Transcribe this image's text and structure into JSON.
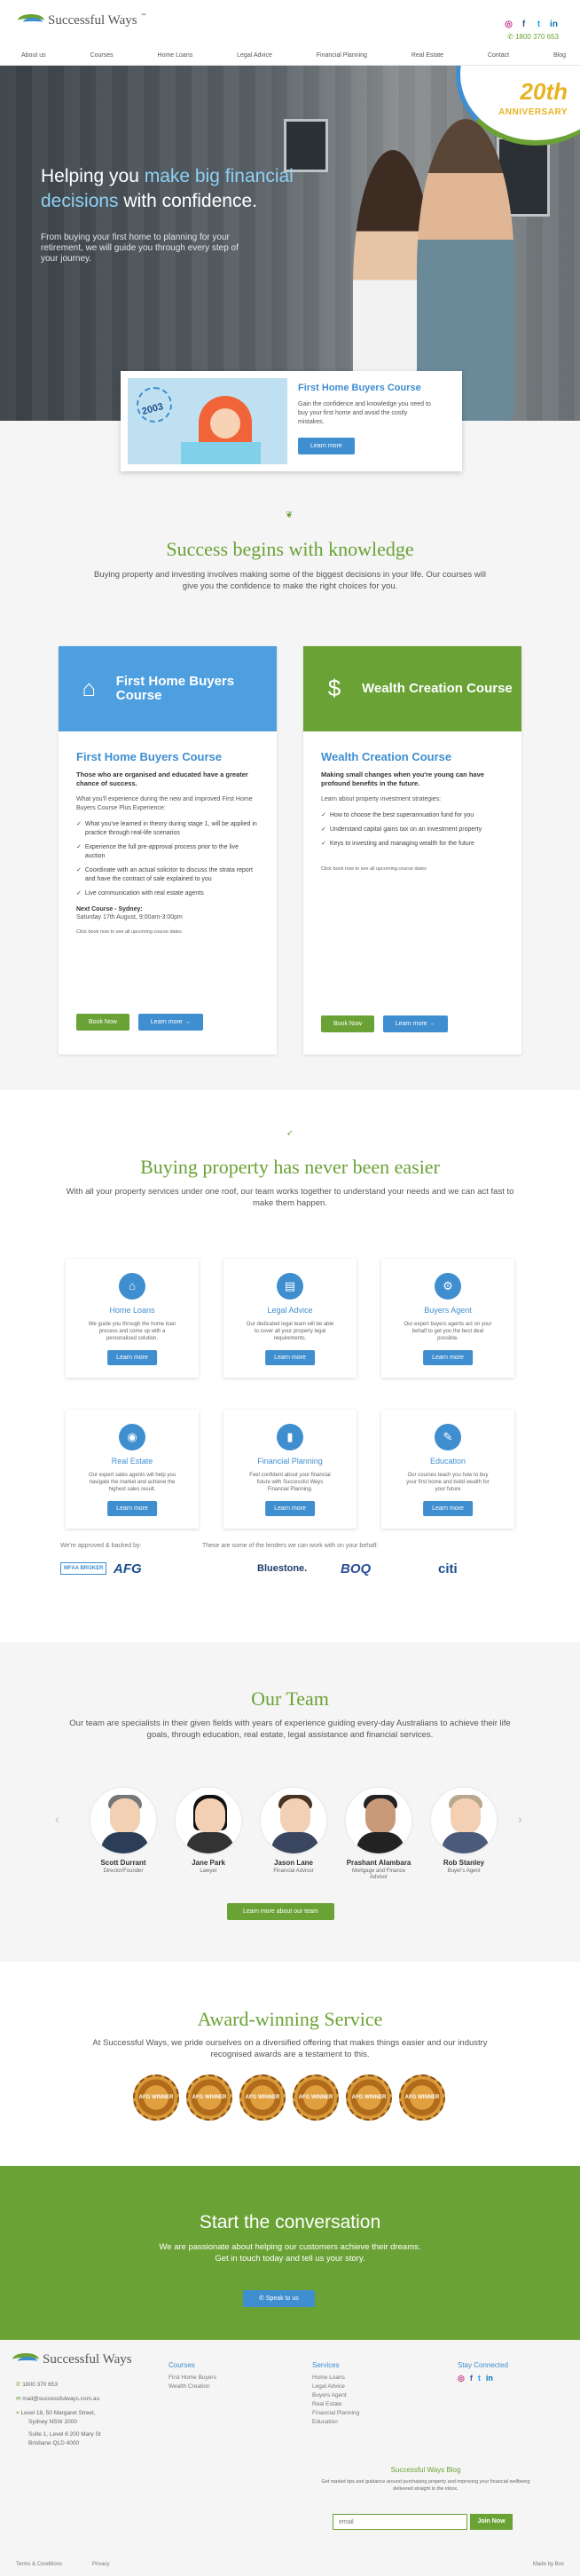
{
  "brand": {
    "name": "Successful Ways",
    "tm": "™",
    "phone": "1800 370 653"
  },
  "social": [
    "instagram-icon",
    "facebook-icon",
    "twitter-icon",
    "linkedin-icon"
  ],
  "social_glyphs": {
    "instagram": "◎",
    "facebook": "f",
    "twitter": "t",
    "linkedin": "in"
  },
  "nav": [
    "About us",
    "Courses",
    "Home Loans",
    "Legal Advice",
    "Financial Planning",
    "Real Estate",
    "Contact",
    "Blog"
  ],
  "anniversary": {
    "number": "20th",
    "label": "ANNIVERSARY"
  },
  "hero": {
    "title_a": "Helping you ",
    "title_hl": "make big financial decisions",
    "title_b": " with confidence.",
    "subtitle": "From buying your first home to planning for your retirement, we will guide you through every step of your journey."
  },
  "promo": {
    "badge": "2003",
    "title": "First Home Buyers Course",
    "desc": "Gain the confidence and knowledge you need to buy your first home and avoid the costly mistakes.",
    "button": "Learn more"
  },
  "knowledge": {
    "title": "Success begins with knowledge",
    "lead": "Buying property and investing involves making some of the biggest decisions in your life. Our courses will give you the confidence to make the right choices for you."
  },
  "course1": {
    "header": "First Home Buyers Course",
    "title": "First Home Buyers Course",
    "bold": "Those who are organised and educated have a greater chance of success.",
    "intro": "What you'll experience during the new and improved First Home Buyers Course Plus Experience:",
    "points": [
      "What you've learned in theory during stage 1, will be applied in practice through real-life scenarios",
      "Experience the full pre-approval process prior to the live auction",
      "Coordinate with an actual solicitor to discuss the strata report and have the contract of sale explained to you",
      "Live communication with real estate agents"
    ],
    "next_label": "Next Course - Sydney:",
    "next_date": "Saturday 17th August, 9:00am-3:00pm",
    "note": "Click book now to see all upcoming course dates",
    "book": "Book Now",
    "learn": "Learn more →"
  },
  "course2": {
    "header": "Wealth Creation Course",
    "title": "Wealth Creation Course",
    "bold": "Making small changes when you're young can have profound benefits in the future.",
    "intro": "Learn about property investment strategies:",
    "points": [
      "How to choose the best superannuation fund for you",
      "Understand capital gains tax on an investment property",
      "Keys to investing and managing wealth for the future"
    ],
    "note": "Click book now to see all upcoming course dates",
    "book": "Book Now",
    "learn": "Learn more →"
  },
  "services": {
    "title": "Buying property has never been easier",
    "lead": "With all your property services under one roof, our team works together to understand your needs and we can act fast to make them happen.",
    "items": [
      {
        "name": "Home Loans",
        "desc": "We guide you through the home loan process and come up with a personalised solution.",
        "button": "Learn more"
      },
      {
        "name": "Legal Advice",
        "desc": "Our dedicated legal team will be able to cover all your property legal requirements.",
        "button": "Learn more"
      },
      {
        "name": "Buyers Agent",
        "desc": "Our expert buyers agents act on your behalf to get you the best deal possible.",
        "button": "Learn more"
      },
      {
        "name": "Real Estate",
        "desc": "Our expert sales agents will help you navigate the market and achieve the highest sales result.",
        "button": "Learn more"
      },
      {
        "name": "Financial Planning",
        "desc": "Feel confident about your financial future with Successful Ways Financial Planning.",
        "button": "Learn more"
      },
      {
        "name": "Education",
        "desc": "Our courses teach you how to buy your first home and build wealth for your future",
        "button": "Learn more"
      }
    ],
    "icon_glyphs": [
      "⌂",
      "▤",
      "⚙",
      "◉",
      "▮",
      "✎"
    ],
    "approved_label": "We're approved & backed by:",
    "lenders_label": "These are some of the lenders we can work with on your behalf:",
    "logos": [
      "MFAA BROKER",
      "AFG",
      "Bluestone.",
      "BOQ",
      "citi"
    ]
  },
  "team": {
    "title": "Our Team",
    "lead": "Our team are specialists in their given fields with years of experience guiding every-day Australians to achieve their life goals, through education, real estate, legal assistance and financial services.",
    "members": [
      {
        "name": "Scott Durrant",
        "role": "Director/Founder"
      },
      {
        "name": "Jane Park",
        "role": "Lawyer"
      },
      {
        "name": "Jason Lane",
        "role": "Financial Advisor"
      },
      {
        "name": "Prashant Alambara",
        "role": "Mortgage and Finance Advisor"
      },
      {
        "name": "Rob Stanley",
        "role": "Buyer's Agent"
      }
    ],
    "prev": "‹",
    "next": "›",
    "button": "Learn more about our team"
  },
  "awards": {
    "title": "Award-winning Service",
    "lead": "At Successful Ways, we pride ourselves on a diversified offering that makes things easier and our industry recognised awards are a testament to this.",
    "medals": [
      "AFG WINNER",
      "AFG WINNER",
      "AFG WINNER",
      "AFG WINNER",
      "AFG WINNER",
      "AFG WINNER"
    ]
  },
  "cta": {
    "title": "Start the conversation",
    "lead": "We are passionate about helping our customers achieve their dreams. Get in touch today and tell us your story.",
    "button": "Speak to us"
  },
  "footer": {
    "phone": "1800 370 653",
    "email": "mail@successfulways.com.au",
    "addr1": "Level 18, 50 Margaret Street,",
    "addr2": "Sydney NSW 2000",
    "addr3": "Suite 1, Level 6 200 Mary St",
    "addr4": "Brisbane QLD 4000",
    "courses_h": "Courses",
    "courses": [
      "First Home Buyers",
      "Wealth Creation"
    ],
    "services_h": "Services",
    "services": [
      "Home Loans",
      "Legal Advice",
      "Buyers Agent",
      "Real Estate",
      "Financial Planning",
      "Education"
    ],
    "connect_h": "Stay Connected",
    "blog_h": "Successful Ways Blog",
    "blog_desc": "Get market tips and guidance around purchasing property and improving your financial wellbeing delivered straight to the inbox.",
    "email_ph": "email",
    "join": "Join Now",
    "terms": "Terms & Conditions",
    "privacy": "Privacy",
    "built": "Made by Box"
  },
  "colors": {
    "green": "#6aa235",
    "blue": "#3f8ed0",
    "gold": "#e7b324"
  }
}
